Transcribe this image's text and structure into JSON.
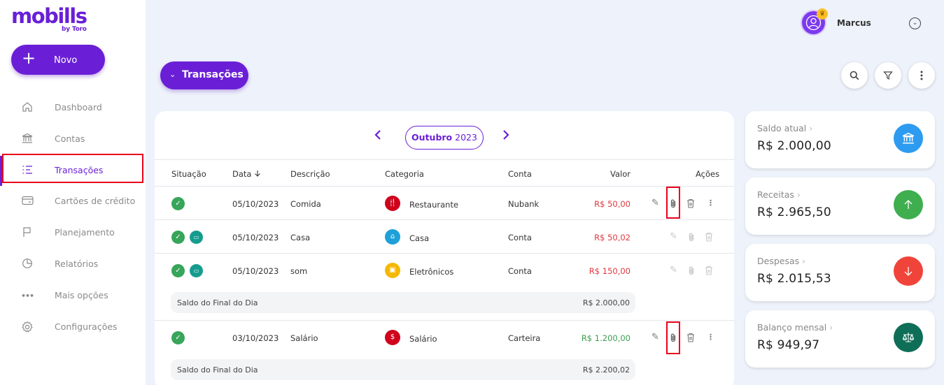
{
  "brand": {
    "name": "mobills",
    "sub": "by Toro"
  },
  "new_button": {
    "icon": "plus-icon",
    "label": "Novo"
  },
  "nav": [
    {
      "label": "Dashboard",
      "icon": "home-icon",
      "active": false
    },
    {
      "label": "Contas",
      "icon": "bank-icon",
      "active": false
    },
    {
      "label": "Transações",
      "icon": "list-icon",
      "active": true
    },
    {
      "label": "Cartões de crédito",
      "icon": "credit-card-icon",
      "active": false
    },
    {
      "label": "Planejamento",
      "icon": "flag-icon",
      "active": false
    },
    {
      "label": "Relatórios",
      "icon": "pie-chart-icon",
      "active": false
    },
    {
      "label": "Mais opções",
      "icon": "more-horizontal-icon",
      "active": false
    },
    {
      "label": "Configurações",
      "icon": "gear-icon",
      "active": false
    }
  ],
  "user": {
    "name": "Marcus",
    "avatar_icon": "user-icon",
    "badge_icon": "crown-icon"
  },
  "page_button": {
    "label": "Transações",
    "icon": "chevron-down-icon"
  },
  "toolbar": {
    "search_icon": "search-icon",
    "filter_icon": "filter-icon",
    "more_icon": "more-vertical-icon"
  },
  "period": {
    "month": "Outubro",
    "year": "2023"
  },
  "columns": {
    "status": "Situação",
    "date": "Data",
    "description": "Descrição",
    "category": "Categoria",
    "account": "Conta",
    "value": "Valor",
    "actions": "Ações"
  },
  "rows": [
    {
      "date": "05/10/2023",
      "description": "Comida",
      "category": "Restaurante",
      "category_icon": "restaurant-icon",
      "category_color": "#d0021b",
      "account": "Nubank",
      "value": "R$ 50,00",
      "value_color": "#e0373d",
      "paid": true,
      "card": false
    },
    {
      "date": "05/10/2023",
      "description": "Casa",
      "category": "Casa",
      "category_icon": "house-icon",
      "category_color": "#1ea0d8",
      "account": "Conta",
      "value": "R$ 50,02",
      "value_color": "#e0373d",
      "paid": true,
      "card": true
    },
    {
      "date": "05/10/2023",
      "description": "som",
      "category": "Eletrônicos",
      "category_icon": "monitor-icon",
      "category_color": "#f5b800",
      "account": "Conta",
      "value": "R$ 150,00",
      "value_color": "#e0373d",
      "paid": true,
      "card": true
    },
    {
      "date": "03/10/2023",
      "description": "Salário",
      "category": "Salário",
      "category_icon": "money-icon",
      "category_color": "#d0021b",
      "account": "Carteira",
      "value": "R$ 1.200,00",
      "value_color": "#3a9e4f",
      "paid": true,
      "card": false
    }
  ],
  "day_summaries": [
    {
      "label": "Saldo do Final do Dia",
      "value": "R$ 2.000,00"
    },
    {
      "label": "Saldo do Final do Dia",
      "value": "R$ 2.200,02"
    }
  ],
  "stats": [
    {
      "title": "Saldo atual",
      "value": "R$ 2.000,00",
      "icon": "bank-icon",
      "color": "#2d9bf0"
    },
    {
      "title": "Receitas",
      "value": "R$ 2.965,50",
      "icon": "arrow-up-icon",
      "color": "#3fae4f"
    },
    {
      "title": "Despesas",
      "value": "R$ 2.015,53",
      "icon": "arrow-down-icon",
      "color": "#f0443a"
    },
    {
      "title": "Balanço mensal",
      "value": "R$ 949,97",
      "icon": "scale-icon",
      "color": "#0f6e57"
    }
  ]
}
